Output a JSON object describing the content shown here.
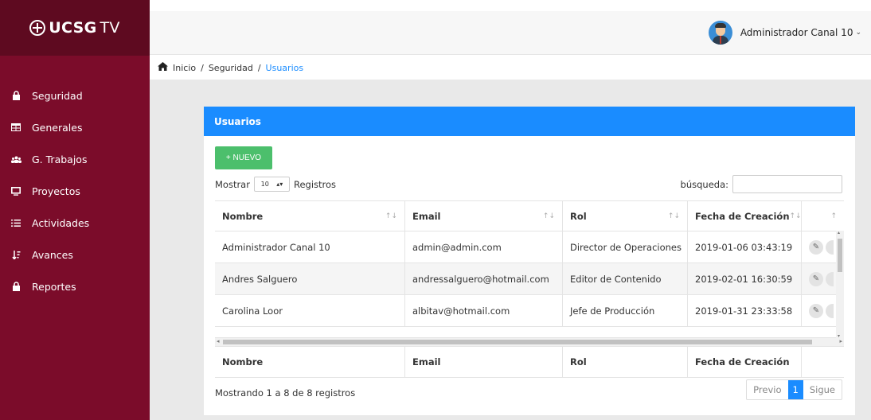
{
  "brand": {
    "main": "UCSG",
    "suffix": "TV"
  },
  "sidebar": {
    "items": [
      {
        "label": "Seguridad",
        "icon": "lock-icon"
      },
      {
        "label": "Generales",
        "icon": "table-icon"
      },
      {
        "label": "G. Trabajos",
        "icon": "users-icon"
      },
      {
        "label": "Proyectos",
        "icon": "monitor-icon"
      },
      {
        "label": "Actividades",
        "icon": "list-icon"
      },
      {
        "label": "Avances",
        "icon": "sort-icon"
      },
      {
        "label": "Reportes",
        "icon": "lock-icon"
      }
    ]
  },
  "header": {
    "user_name": "Administrador Canal 10",
    "caret": "⌄"
  },
  "breadcrumb": {
    "home": "Inicio",
    "section": "Seguridad",
    "current": "Usuarios",
    "separator": "/"
  },
  "card": {
    "title": "Usuarios"
  },
  "toolbar": {
    "new_label": "+ NUEVO",
    "show_label": "Mostrar",
    "page_size": "10",
    "records_label": "Registros",
    "search_label": "búsqueda:",
    "search_value": ""
  },
  "table": {
    "columns": [
      "Nombre",
      "Email",
      "Rol",
      "Fecha de Creación",
      ""
    ],
    "rows": [
      {
        "nombre": "Administrador Canal 10",
        "email": "admin@admin.com",
        "rol": "Director de Operaciones",
        "fecha": "2019-01-06 03:43:19"
      },
      {
        "nombre": "Andres Salguero",
        "email": "andressalguero@hotmail.com",
        "rol": "Editor de Contenido",
        "fecha": "2019-02-01 16:30:59"
      },
      {
        "nombre": "Carolina Loor",
        "email": "albitav@hotmail.com",
        "rol": "Jefe de Producción",
        "fecha": "2019-01-31 23:33:58"
      }
    ],
    "footer_columns": [
      "Nombre",
      "Email",
      "Rol",
      "Fecha de Creación"
    ]
  },
  "pagination": {
    "info": "Mostrando 1 a 8 de 8 registros",
    "prev": "Previo",
    "current": "1",
    "next": "Sigue"
  },
  "colors": {
    "sidebar": "#7b0c2a",
    "brand_bg": "#5e0a20",
    "accent": "#1a8cff",
    "success": "#4cbf6c"
  }
}
